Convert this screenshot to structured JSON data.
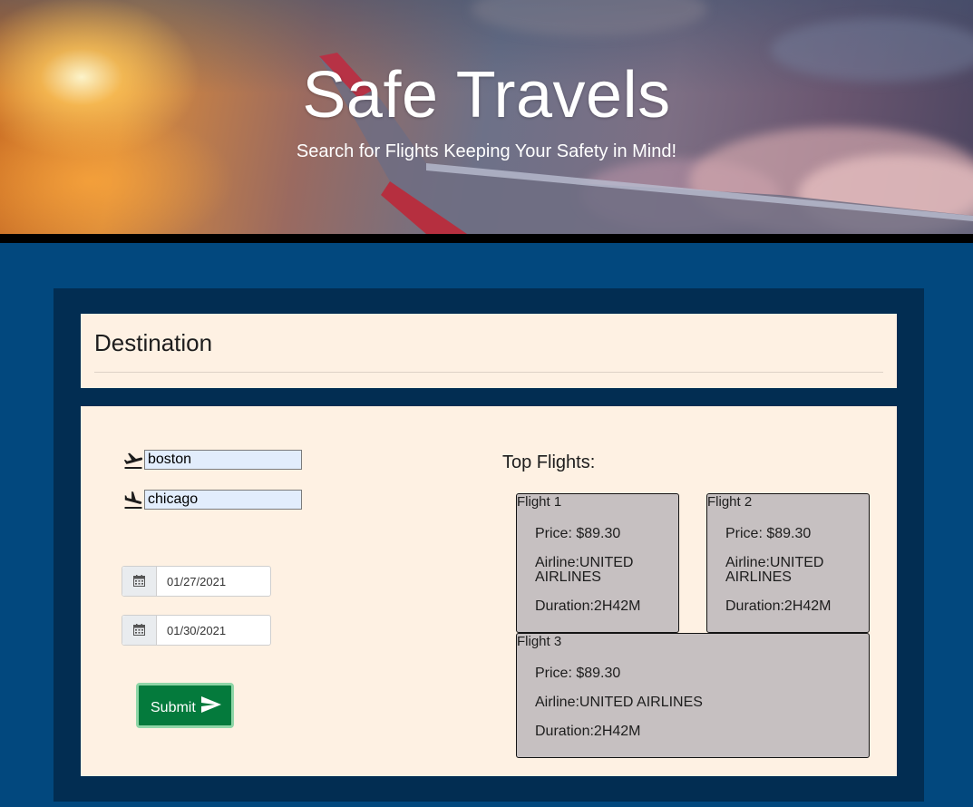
{
  "hero": {
    "title": "Safe Travels",
    "subtitle": "Search for Flights Keeping Your Safety in Mind!"
  },
  "destination": {
    "heading": "Destination"
  },
  "search": {
    "departure_icon": "flight-takeoff-icon",
    "arrival_icon": "flight-land-icon",
    "origin_value": "boston",
    "destination_value": "chicago",
    "depart_date": "01/27/2021",
    "return_date": "01/30/2021",
    "calendar_icon": "calendar-icon",
    "submit_label": "Submit",
    "submit_icon": "send-icon"
  },
  "results": {
    "heading": "Top Flights:",
    "flights": [
      {
        "name": "Flight 1",
        "price": "Price: $89.30",
        "airline_1": "Airline:UNITED",
        "airline_2": "AIRLINES",
        "duration": "Duration:2H42M"
      },
      {
        "name": "Flight 2",
        "price": "Price: $89.30",
        "airline_1": "Airline:UNITED",
        "airline_2": "AIRLINES",
        "duration": "Duration:2H42M"
      },
      {
        "name": "Flight 3",
        "price": "Price: $89.30",
        "airline": "Airline:UNITED AIRLINES",
        "duration": "Duration:2H42M"
      }
    ]
  },
  "colors": {
    "page_background": "#02487e",
    "panel_background": "#022d52",
    "card_background": "#fef1e3",
    "flight_card": "#c6c0c1",
    "submit_button": "#047a3c",
    "input_fill": "#e2edfc"
  }
}
